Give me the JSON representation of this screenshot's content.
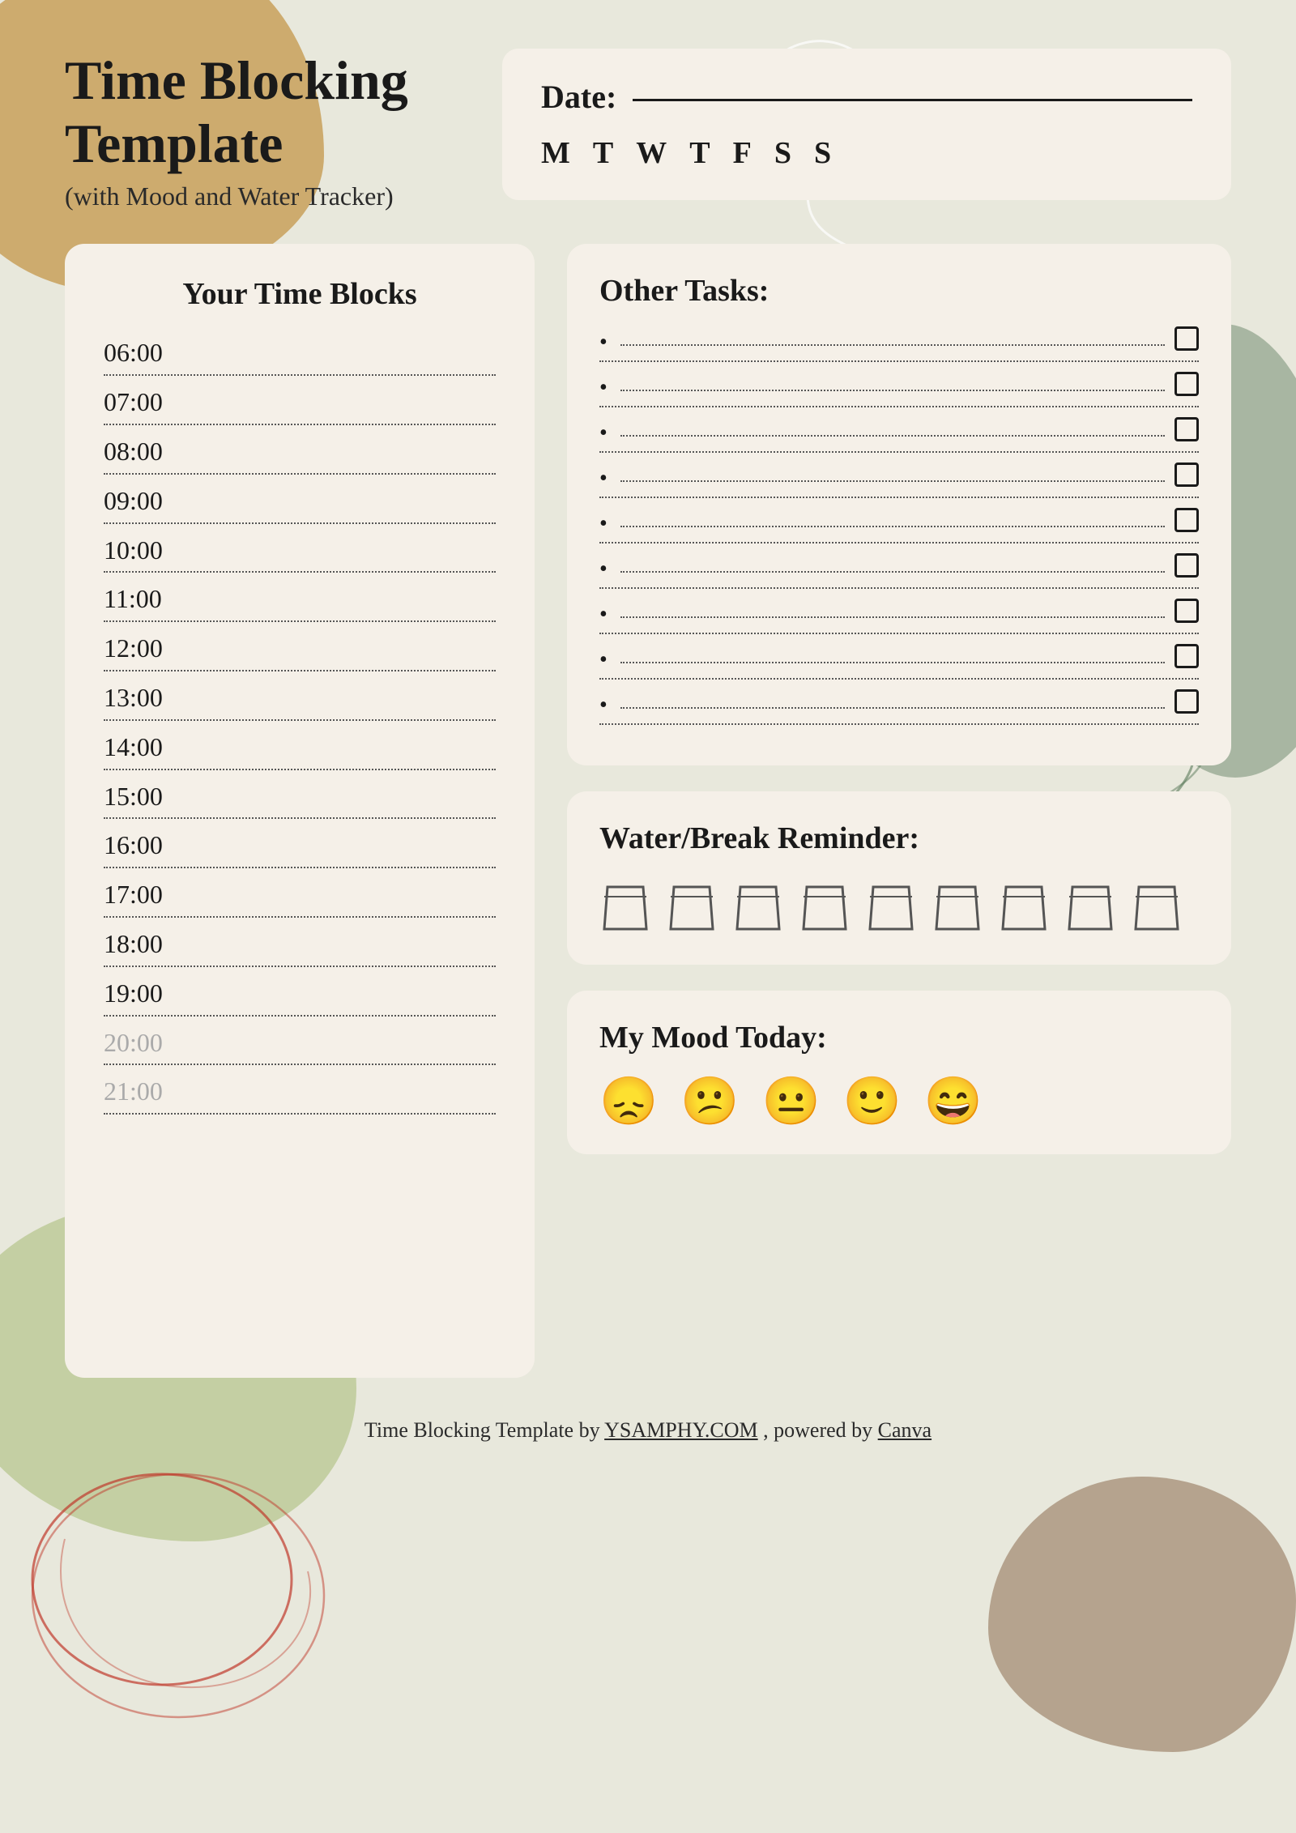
{
  "page": {
    "background_color": "#e8e8dc"
  },
  "header": {
    "main_title": "Time Blocking Template",
    "subtitle": "(with Mood and Water Tracker)",
    "date_label": "Date:",
    "days": [
      "M",
      "T",
      "W",
      "T",
      "F",
      "S",
      "S"
    ]
  },
  "time_blocks": {
    "panel_title": "Your Time Blocks",
    "times": [
      "06:00",
      "07:00",
      "08:00",
      "09:00",
      "10:00",
      "11:00",
      "12:00",
      "13:00",
      "14:00",
      "15:00",
      "16:00",
      "17:00",
      "18:00",
      "19:00",
      "20:00",
      "21:00"
    ],
    "faded_times": [
      "20:00",
      "21:00"
    ]
  },
  "other_tasks": {
    "title": "Other Tasks:",
    "count": 9
  },
  "water_tracker": {
    "title": "Water/Break Reminder:",
    "cup_count": 9
  },
  "mood_tracker": {
    "title": "My Mood Today:",
    "emojis": [
      "😞",
      "😕",
      "😐",
      "🙂",
      "😄"
    ]
  },
  "footer": {
    "text_before": "Time Blocking Template by ",
    "site": "YSAMPHY.COM",
    "text_middle": " , powered by ",
    "canva": "Canva"
  }
}
